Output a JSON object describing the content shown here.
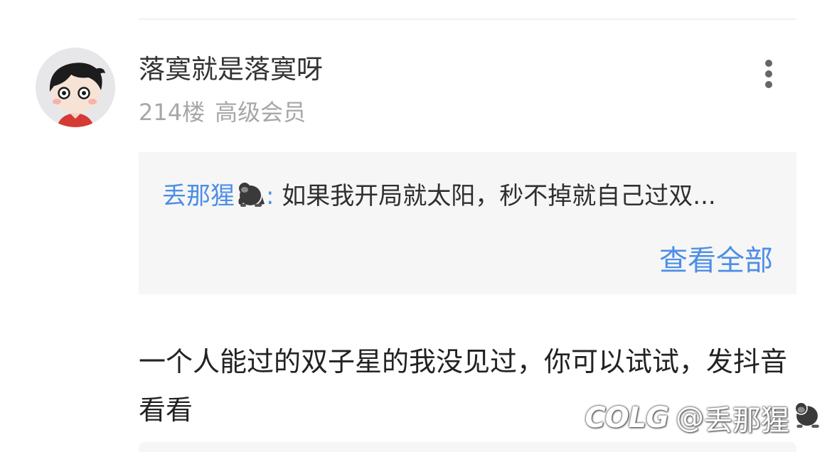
{
  "post": {
    "username": "落寞就是落寞呀",
    "floor": "214楼",
    "member_level": "高级会员",
    "quote": {
      "author": "丢那猩",
      "author_icon": "gorilla-emoji",
      "colon": ":",
      "text": "如果我开局就太阳，秒不掉就自己过双...",
      "view_all_label": "查看全部"
    },
    "reply_text": "一个人能过的双子星的我没见过，你可以试试，发抖音看看"
  },
  "watermark": {
    "logo": "COLG",
    "at": "@",
    "name": "丢那猩",
    "icon": "gorilla-emoji"
  },
  "colors": {
    "link": "#4d8ee6",
    "quote_bg": "#f6f6f6",
    "meta_text": "#a7a7a7"
  }
}
